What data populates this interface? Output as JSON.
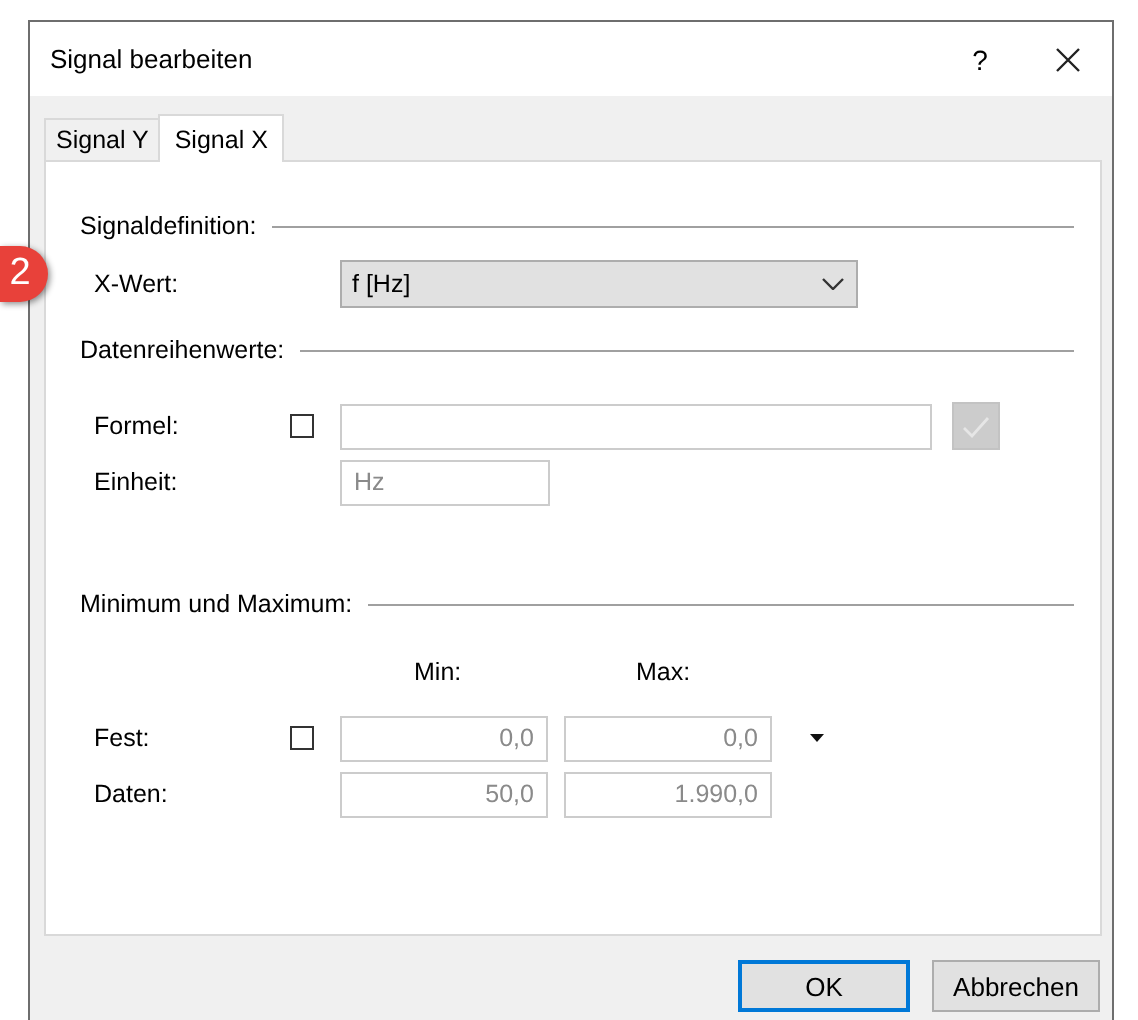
{
  "window": {
    "title": "Signal bearbeiten",
    "help_button": "?"
  },
  "callout": {
    "label": "2"
  },
  "tabs": [
    {
      "label": "Signal Y",
      "selected": false
    },
    {
      "label": "Signal X",
      "selected": true
    }
  ],
  "signal_definition": {
    "heading": "Signaldefinition:",
    "x_value": {
      "label": "X-Wert:",
      "value": "f [Hz]"
    }
  },
  "series_values": {
    "heading": "Datenreihenwerte:",
    "formula": {
      "label": "Formel:",
      "checked": false,
      "apply_disabled": true
    },
    "unit": {
      "label": "Einheit:",
      "value": "Hz",
      "disabled": true
    }
  },
  "min_max": {
    "heading": "Minimum und Maximum:",
    "columns": [
      "Min:",
      "Max:"
    ],
    "rows": [
      {
        "label": "Fest:",
        "kind": "checkbox",
        "checked": false,
        "disabled": true,
        "min": "0,0",
        "max": "0,0"
      },
      {
        "label": "Daten:",
        "kind": "plain",
        "disabled": true,
        "min": "50,0",
        "max": "1.990,0"
      }
    ]
  },
  "buttons": [
    {
      "label": "OK",
      "default": true
    },
    {
      "label": "Abbrechen",
      "default": false
    }
  ]
}
